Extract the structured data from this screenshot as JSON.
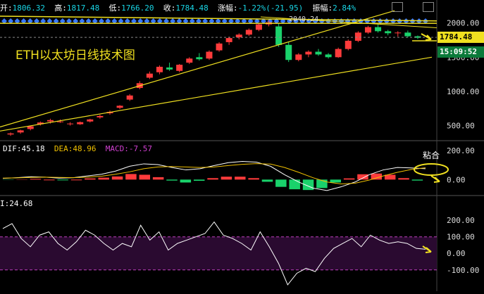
{
  "header": {
    "open_label": "开:",
    "open_value": "1806.32",
    "high_label": "高:",
    "high_value": "1817.48",
    "low_label": "低:",
    "low_value": "1766.20",
    "close_label": "收:",
    "close_value": "1784.48",
    "change_label": "涨幅:",
    "change_value": "-1.22%(-21.95)",
    "amp_label": "振幅:",
    "amp_value": "2.84%"
  },
  "title": "ETH以太坊日线技术图",
  "price_tag": {
    "last": "1784.48",
    "countdown": "15:09:52"
  },
  "peak_label": "2040.24",
  "macd_row": {
    "dif_label": "DIF:",
    "dif_value": "45.18",
    "dea_label": "DEA:",
    "dea_value": "48.96",
    "macd_label": "MACD:",
    "macd_value": "-7.57"
  },
  "rsi_row": {
    "label": "I:",
    "value": "24.68"
  },
  "annotation": "粘合",
  "colors": {
    "up": "#ff3b3b",
    "down": "#19d26b",
    "trend": "#f0e020",
    "dif": "#ffffff",
    "dea": "#f0c000",
    "diamond": "#3a7bff",
    "band": "#2a0a30"
  },
  "chart_data": [
    {
      "type": "candlestick",
      "y_ticks": [
        "2000.00",
        "1500.00",
        "1000.00",
        "500.00"
      ],
      "ylim": [
        300,
        2110
      ],
      "candles_ohlc_sampled": [
        [
          370,
          400,
          350,
          385
        ],
        [
          400,
          440,
          380,
          430
        ],
        [
          450,
          500,
          430,
          490
        ],
        [
          520,
          560,
          500,
          545
        ],
        [
          560,
          600,
          530,
          580
        ],
        [
          560,
          590,
          540,
          560
        ],
        [
          520,
          550,
          500,
          530
        ],
        [
          520,
          560,
          510,
          550
        ],
        [
          560,
          600,
          545,
          590
        ],
        [
          620,
          660,
          600,
          640
        ],
        [
          680,
          720,
          660,
          700
        ],
        [
          760,
          800,
          740,
          790
        ],
        [
          880,
          960,
          860,
          940
        ],
        [
          1050,
          1150,
          1030,
          1120
        ],
        [
          1200,
          1290,
          1180,
          1260
        ],
        [
          1280,
          1380,
          1250,
          1360
        ],
        [
          1350,
          1420,
          1300,
          1320
        ],
        [
          1300,
          1400,
          1280,
          1390
        ],
        [
          1420,
          1500,
          1400,
          1480
        ],
        [
          1500,
          1560,
          1450,
          1470
        ],
        [
          1480,
          1600,
          1460,
          1580
        ],
        [
          1600,
          1720,
          1580,
          1700
        ],
        [
          1720,
          1800,
          1680,
          1780
        ],
        [
          1790,
          1850,
          1760,
          1830
        ],
        [
          1830,
          1920,
          1810,
          1900
        ],
        [
          1900,
          2000,
          1880,
          1980
        ],
        [
          1980,
          2040,
          1950,
          2010
        ],
        [
          1950,
          1990,
          1650,
          1680
        ],
        [
          1680,
          1720,
          1430,
          1460
        ],
        [
          1460,
          1560,
          1440,
          1540
        ],
        [
          1540,
          1600,
          1500,
          1580
        ],
        [
          1580,
          1620,
          1520,
          1540
        ],
        [
          1540,
          1560,
          1480,
          1500
        ],
        [
          1500,
          1640,
          1490,
          1620
        ],
        [
          1620,
          1760,
          1600,
          1740
        ],
        [
          1740,
          1880,
          1720,
          1860
        ],
        [
          1860,
          1960,
          1840,
          1940
        ],
        [
          1940,
          1980,
          1860,
          1880
        ],
        [
          1880,
          1900,
          1820,
          1850
        ],
        [
          1850,
          1880,
          1800,
          1860
        ],
        [
          1860,
          1890,
          1790,
          1806
        ],
        [
          1806,
          1817,
          1766,
          1784
        ]
      ]
    },
    {
      "type": "line",
      "dif_sampled": [
        5,
        8,
        12,
        10,
        6,
        8,
        15,
        22,
        35,
        55,
        65,
        62,
        50,
        40,
        45,
        58,
        70,
        75,
        72,
        55,
        20,
        -10,
        -35,
        -45,
        -30,
        -10,
        20,
        40,
        50,
        48,
        45
      ],
      "dea_sampled": [
        6,
        7,
        9,
        10,
        9,
        8,
        10,
        14,
        22,
        32,
        45,
        52,
        54,
        52,
        50,
        52,
        58,
        63,
        66,
        64,
        50,
        30,
        8,
        -10,
        -18,
        -15,
        -2,
        15,
        30,
        42,
        49
      ],
      "macd_sampled": [
        -1,
        1,
        3,
        0,
        -3,
        0,
        5,
        8,
        13,
        23,
        20,
        10,
        -4,
        -12,
        -5,
        6,
        12,
        12,
        6,
        -9,
        -30,
        -40,
        -43,
        -35,
        -12,
        5,
        22,
        25,
        20,
        6,
        -4
      ],
      "y_ticks": [
        "200.00",
        "0.00"
      ],
      "ylim": [
        -60,
        120
      ]
    },
    {
      "type": "line",
      "rsi_sampled": [
        150,
        180,
        90,
        40,
        110,
        130,
        60,
        20,
        70,
        140,
        110,
        60,
        20,
        60,
        40,
        170,
        80,
        130,
        20,
        60,
        80,
        100,
        120,
        190,
        110,
        90,
        60,
        20,
        130,
        40,
        -60,
        -190,
        -120,
        -90,
        -110,
        -30,
        30,
        60,
        90,
        40,
        110,
        80,
        60,
        70,
        60,
        30,
        24.68
      ],
      "y_ticks": [
        "200.00",
        "100.00",
        "0.00",
        "-100.00"
      ],
      "ylim": [
        -220,
        290
      ]
    }
  ]
}
